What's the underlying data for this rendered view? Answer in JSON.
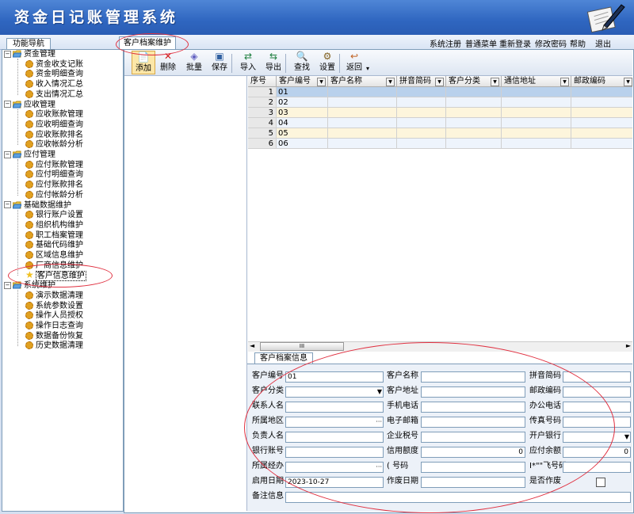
{
  "app": {
    "title": "资金日记账管理系统"
  },
  "header_menu": [
    "系统注册",
    "普通菜单",
    "重新登录",
    "修改密码",
    "帮助",
    "退出"
  ],
  "nav": {
    "tab": "功能导航",
    "groups": [
      {
        "label": "资金管理",
        "items": [
          "资金收支记账",
          "资金明细查询",
          "收入情况汇总",
          "支出情况汇总"
        ]
      },
      {
        "label": "应收管理",
        "items": [
          "应收账款管理",
          "应收明细查询",
          "应收账款排名",
          "应收帐龄分析"
        ]
      },
      {
        "label": "应付管理",
        "items": [
          "应付账款管理",
          "应付明细查询",
          "应付账款排名",
          "应付帐龄分析"
        ]
      },
      {
        "label": "基础数据维护",
        "items": [
          "银行账户设置",
          "组织机构维护",
          "职工档案管理",
          "基础代码维护",
          "区域信息维护",
          "厂商信息维护",
          "客户信息维护"
        ]
      },
      {
        "label": "系统维护",
        "items": [
          "演示数据清理",
          "系统参数设置",
          "操作人员授权",
          "操作日志查询",
          "数据备份恢复",
          "历史数据清理"
        ]
      }
    ],
    "selected": "客户信息维护"
  },
  "content_tab": "客户档案维护",
  "toolbar": [
    {
      "label": "添加",
      "icon": "add-icon"
    },
    {
      "label": "删除",
      "icon": "delete-icon"
    },
    {
      "label": "批量",
      "icon": "batch-icon"
    },
    {
      "label": "保存",
      "icon": "save-icon"
    },
    {
      "label": "导入",
      "icon": "import-icon"
    },
    {
      "label": "导出",
      "icon": "export-icon"
    },
    {
      "label": "查找",
      "icon": "find-icon"
    },
    {
      "label": "设置",
      "icon": "settings-icon"
    },
    {
      "label": "返回",
      "icon": "return-icon"
    }
  ],
  "grid": {
    "columns": [
      "序号",
      "客户编号",
      "客户名称",
      "拼音简码",
      "客户分类",
      "通信地址",
      "邮政编码"
    ],
    "rows": [
      {
        "seq": "1",
        "code": "01"
      },
      {
        "seq": "2",
        "code": "02"
      },
      {
        "seq": "3",
        "code": "03"
      },
      {
        "seq": "4",
        "code": "04"
      },
      {
        "seq": "5",
        "code": "05"
      },
      {
        "seq": "6",
        "code": "06"
      }
    ],
    "scroll_thumb": "III"
  },
  "detail": {
    "tab": "客户档案信息",
    "fields": {
      "code": {
        "label": "客户编号",
        "value": "01"
      },
      "name": {
        "label": "客户名称",
        "value": ""
      },
      "pinyin": {
        "label": "拼音简码",
        "value": ""
      },
      "category": {
        "label": "客户分类",
        "value": ""
      },
      "address": {
        "label": "客户地址",
        "value": ""
      },
      "postcode": {
        "label": "邮政编码",
        "value": ""
      },
      "contact": {
        "label": "联系人名",
        "value": ""
      },
      "mobile": {
        "label": "手机电话",
        "value": ""
      },
      "office_phone": {
        "label": "办公电话",
        "value": ""
      },
      "region": {
        "label": "所属地区",
        "value": ""
      },
      "email": {
        "label": "电子邮箱",
        "value": ""
      },
      "fax": {
        "label": "传真号码",
        "value": ""
      },
      "owner": {
        "label": "负责人名",
        "value": ""
      },
      "tax_no": {
        "label": "企业税号",
        "value": ""
      },
      "bank": {
        "label": "开户银行",
        "value": ""
      },
      "bank_account": {
        "label": "银行账号",
        "value": ""
      },
      "credit_limit": {
        "label": "信用额度",
        "value": "0"
      },
      "receivable": {
        "label": "应付余额",
        "value": "0"
      },
      "agent": {
        "label": "所属经办",
        "value": ""
      },
      "qq": {
        "label": "(      号码",
        "value": ""
      },
      "other_no": {
        "label": "I*\"\"飞号码",
        "value": ""
      },
      "start_date": {
        "label": "启用日期",
        "value": "2023-10-27"
      },
      "void_date": {
        "label": "作废日期",
        "value": ""
      },
      "voided": {
        "label": "是否作废",
        "value": ""
      },
      "remark": {
        "label": "备注信息",
        "value": ""
      }
    }
  },
  "colors": {
    "header": "#2f66c0",
    "selected_row": "#b9d1ec",
    "row_alt": "#fdf5dc",
    "annotation": "#e03040"
  }
}
